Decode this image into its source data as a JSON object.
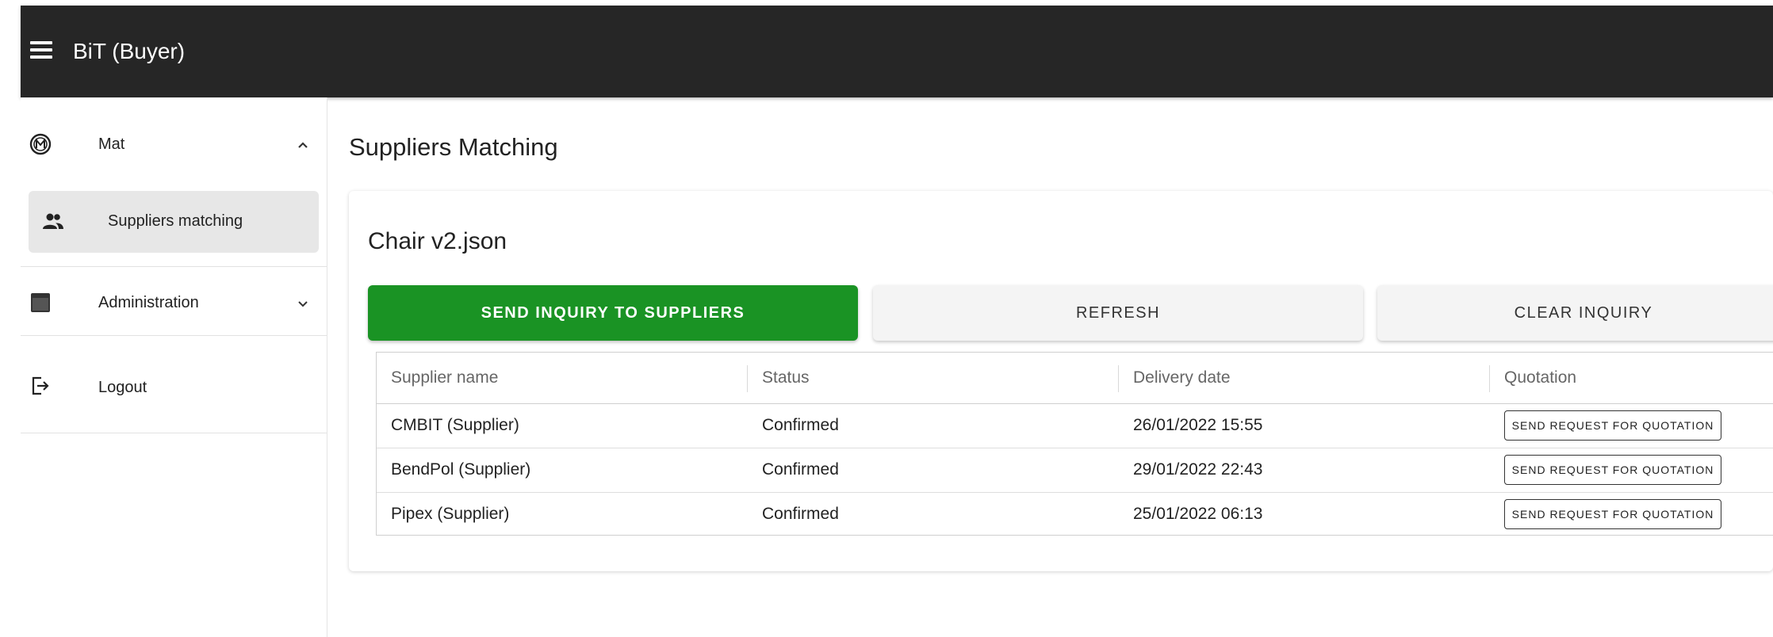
{
  "app": {
    "title": "BiT (Buyer)"
  },
  "sidebar": {
    "items": [
      {
        "label": "Mat"
      },
      {
        "label": "Suppliers matching"
      },
      {
        "label": "Administration"
      },
      {
        "label": "Logout"
      }
    ]
  },
  "main": {
    "page_title": "Suppliers Matching",
    "file_title": "Chair v2.json",
    "buttons": {
      "send_inquiry": "SEND INQUIRY TO SUPPLIERS",
      "refresh": "REFRESH",
      "clear": "CLEAR INQUIRY"
    },
    "table": {
      "columns": [
        "Supplier name",
        "Status",
        "Delivery date",
        "Quotation"
      ],
      "rows": [
        {
          "name": "CMBIT (Supplier)",
          "status": "Confirmed",
          "date": "26/01/2022 15:55",
          "action": "SEND REQUEST FOR QUOTATION"
        },
        {
          "name": "BendPol (Supplier)",
          "status": "Confirmed",
          "date": "29/01/2022 22:43",
          "action": "SEND REQUEST FOR QUOTATION"
        },
        {
          "name": "Pipex (Supplier)",
          "status": "Confirmed",
          "date": "25/01/2022 06:13",
          "action": "SEND REQUEST FOR QUOTATION"
        }
      ]
    }
  },
  "colors": {
    "topbar": "#262626",
    "primary": "#1a9324",
    "active_bg": "#e7e7e7"
  }
}
